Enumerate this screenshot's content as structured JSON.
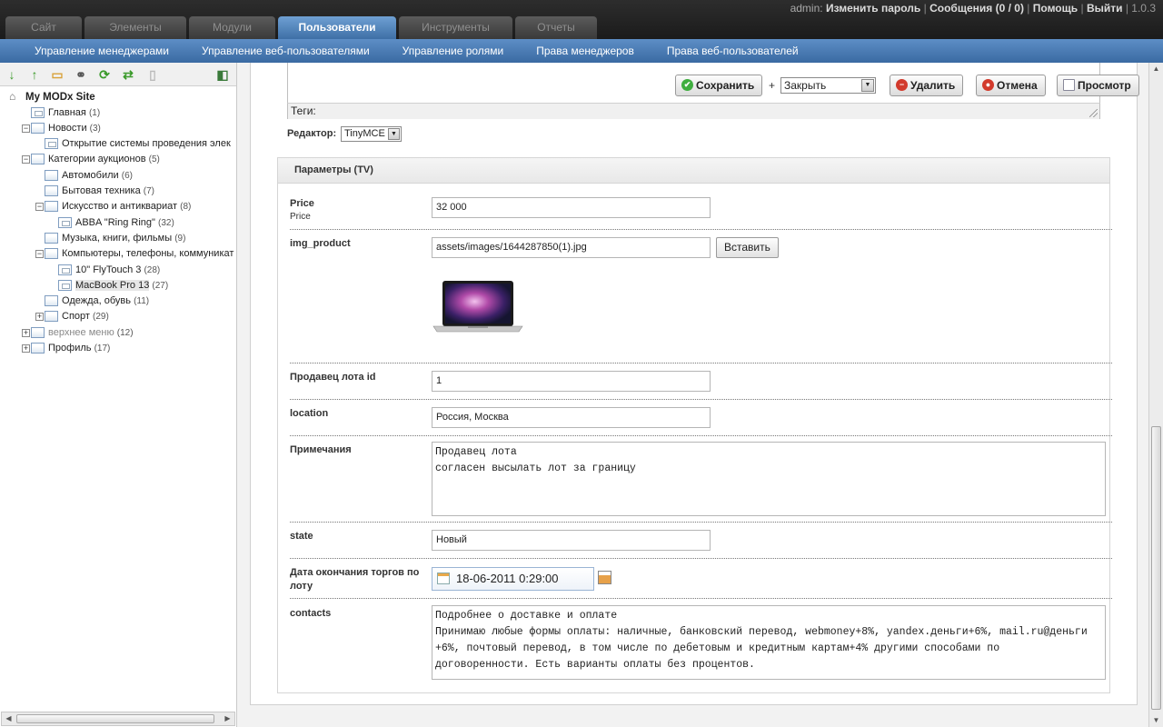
{
  "header": {
    "tabs": [
      {
        "label": "Сайт"
      },
      {
        "label": "Элементы"
      },
      {
        "label": "Модули"
      },
      {
        "label": "Пользователи"
      },
      {
        "label": "Инструменты"
      },
      {
        "label": "Отчеты"
      }
    ],
    "active_tab": "Пользователи",
    "user": "admin:",
    "links": [
      "Изменить пароль",
      "Сообщения (0 / 0)",
      "Помощь",
      "Выйти"
    ],
    "version": "1.0.3"
  },
  "subnav": [
    "Управление менеджерами",
    "Управление веб-пользователями",
    "Управление ролями",
    "Права менеджеров",
    "Права веб-пользователей"
  ],
  "tree": {
    "root": "My MODx Site",
    "nodes": [
      {
        "label": "Главная",
        "count": "(1)"
      },
      {
        "label": "Новости",
        "count": "(3)"
      },
      {
        "label": "Открытие системы проведения элек",
        "count": ""
      },
      {
        "label": "Категории аукционов",
        "count": "(5)"
      },
      {
        "label": "Автомобили",
        "count": "(6)"
      },
      {
        "label": "Бытовая техника",
        "count": "(7)"
      },
      {
        "label": "Искусство и антиквариат",
        "count": "(8)"
      },
      {
        "label": "ABBA \"Ring Ring\"",
        "count": "(32)"
      },
      {
        "label": "Музыка, книги, фильмы",
        "count": "(9)"
      },
      {
        "label": "Компьютеры, телефоны, коммуникат",
        "count": ""
      },
      {
        "label": "10\" FlyTouch 3",
        "count": "(28)"
      },
      {
        "label": "MacBook Pro 13",
        "count": "(27)"
      },
      {
        "label": "Одежда, обувь",
        "count": "(11)"
      },
      {
        "label": "Спорт",
        "count": "(29)"
      },
      {
        "label": "верхнее меню",
        "count": "(12)"
      },
      {
        "label": "Профиль",
        "count": "(17)"
      }
    ]
  },
  "actions": {
    "save": "Сохранить",
    "plus": "+",
    "after_save": "Закрыть",
    "delete": "Удалить",
    "cancel": "Отмена",
    "preview": "Просмотр"
  },
  "editor": {
    "tags_label": "Теги:",
    "editor_label": "Редактор:",
    "editor_value": "TinyMCE"
  },
  "tv": {
    "title": "Параметры (TV)",
    "price": {
      "label": "Price",
      "sub": "Price",
      "value": "32 000"
    },
    "img_product": {
      "label": "img_product",
      "value": "assets/images/1644287850(1).jpg",
      "button": "Вставить"
    },
    "seller": {
      "label": "Продавец лота id",
      "value": "1"
    },
    "location": {
      "label": "location",
      "value": "Россия, Москва"
    },
    "notes": {
      "label": "Примечания",
      "value": "Продавец лота\nсогласен высылать лот за границу"
    },
    "state": {
      "label": "state",
      "value": "Новый"
    },
    "end_date": {
      "label": "Дата окончания торгов по лоту",
      "value": "18-06-2011 0:29:00"
    },
    "contacts": {
      "label": "contacts",
      "value": "Подробнее о доставке и оплате\nПринимаю любые формы оплаты: наличные, банковский перевод, webmoney+8%, yandex.деньги+6%, mail.ru@деньги\n+6%, почтовый перевод, в том числе по дебетовым и кредитным картам+4% другими способами по\nдоговоренности. Есть варианты оплаты без процентов."
    }
  },
  "colors": {
    "accent": "#4a7cb4",
    "topbar": "#222222"
  }
}
